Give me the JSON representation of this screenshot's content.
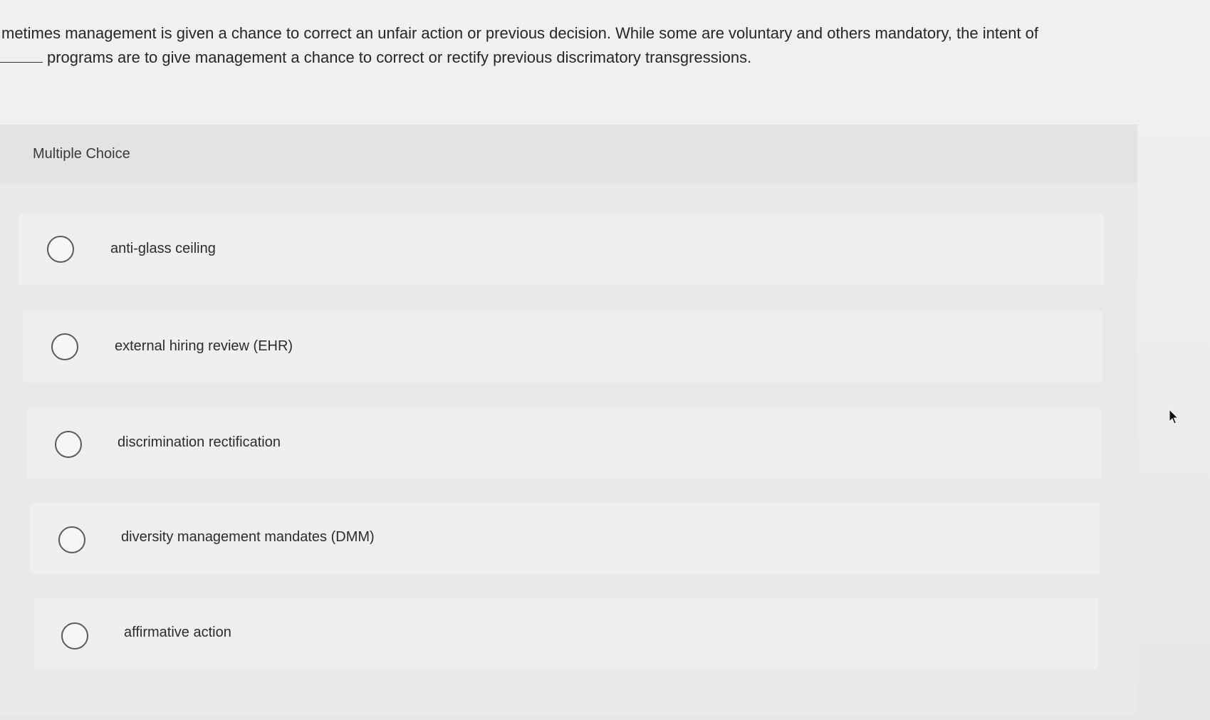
{
  "question": {
    "line1": "metimes management is given a chance to correct an unfair action or previous decision. While some are voluntary and others mandatory, the intent of",
    "line2": "programs are to give management a chance to correct or rectify previous discrimatory transgressions."
  },
  "multiple_choice_label": "Multiple Choice",
  "options": [
    {
      "label": "anti-glass ceiling"
    },
    {
      "label": "external hiring review (EHR)"
    },
    {
      "label": "discrimination rectification"
    },
    {
      "label": "diversity management mandates (DMM)"
    },
    {
      "label": "affirmative action"
    }
  ]
}
